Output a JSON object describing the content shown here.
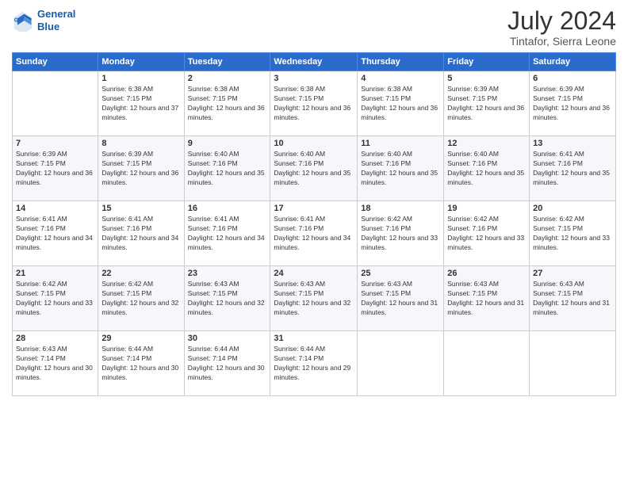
{
  "logo": {
    "line1": "General",
    "line2": "Blue"
  },
  "title": "July 2024",
  "location": "Tintafor, Sierra Leone",
  "weekdays": [
    "Sunday",
    "Monday",
    "Tuesday",
    "Wednesday",
    "Thursday",
    "Friday",
    "Saturday"
  ],
  "weeks": [
    [
      {
        "day": "",
        "sunrise": "",
        "sunset": "",
        "daylight": ""
      },
      {
        "day": "1",
        "sunrise": "Sunrise: 6:38 AM",
        "sunset": "Sunset: 7:15 PM",
        "daylight": "Daylight: 12 hours and 37 minutes."
      },
      {
        "day": "2",
        "sunrise": "Sunrise: 6:38 AM",
        "sunset": "Sunset: 7:15 PM",
        "daylight": "Daylight: 12 hours and 36 minutes."
      },
      {
        "day": "3",
        "sunrise": "Sunrise: 6:38 AM",
        "sunset": "Sunset: 7:15 PM",
        "daylight": "Daylight: 12 hours and 36 minutes."
      },
      {
        "day": "4",
        "sunrise": "Sunrise: 6:38 AM",
        "sunset": "Sunset: 7:15 PM",
        "daylight": "Daylight: 12 hours and 36 minutes."
      },
      {
        "day": "5",
        "sunrise": "Sunrise: 6:39 AM",
        "sunset": "Sunset: 7:15 PM",
        "daylight": "Daylight: 12 hours and 36 minutes."
      },
      {
        "day": "6",
        "sunrise": "Sunrise: 6:39 AM",
        "sunset": "Sunset: 7:15 PM",
        "daylight": "Daylight: 12 hours and 36 minutes."
      }
    ],
    [
      {
        "day": "7",
        "sunrise": "Sunrise: 6:39 AM",
        "sunset": "Sunset: 7:15 PM",
        "daylight": "Daylight: 12 hours and 36 minutes."
      },
      {
        "day": "8",
        "sunrise": "Sunrise: 6:39 AM",
        "sunset": "Sunset: 7:15 PM",
        "daylight": "Daylight: 12 hours and 36 minutes."
      },
      {
        "day": "9",
        "sunrise": "Sunrise: 6:40 AM",
        "sunset": "Sunset: 7:16 PM",
        "daylight": "Daylight: 12 hours and 35 minutes."
      },
      {
        "day": "10",
        "sunrise": "Sunrise: 6:40 AM",
        "sunset": "Sunset: 7:16 PM",
        "daylight": "Daylight: 12 hours and 35 minutes."
      },
      {
        "day": "11",
        "sunrise": "Sunrise: 6:40 AM",
        "sunset": "Sunset: 7:16 PM",
        "daylight": "Daylight: 12 hours and 35 minutes."
      },
      {
        "day": "12",
        "sunrise": "Sunrise: 6:40 AM",
        "sunset": "Sunset: 7:16 PM",
        "daylight": "Daylight: 12 hours and 35 minutes."
      },
      {
        "day": "13",
        "sunrise": "Sunrise: 6:41 AM",
        "sunset": "Sunset: 7:16 PM",
        "daylight": "Daylight: 12 hours and 35 minutes."
      }
    ],
    [
      {
        "day": "14",
        "sunrise": "Sunrise: 6:41 AM",
        "sunset": "Sunset: 7:16 PM",
        "daylight": "Daylight: 12 hours and 34 minutes."
      },
      {
        "day": "15",
        "sunrise": "Sunrise: 6:41 AM",
        "sunset": "Sunset: 7:16 PM",
        "daylight": "Daylight: 12 hours and 34 minutes."
      },
      {
        "day": "16",
        "sunrise": "Sunrise: 6:41 AM",
        "sunset": "Sunset: 7:16 PM",
        "daylight": "Daylight: 12 hours and 34 minutes."
      },
      {
        "day": "17",
        "sunrise": "Sunrise: 6:41 AM",
        "sunset": "Sunset: 7:16 PM",
        "daylight": "Daylight: 12 hours and 34 minutes."
      },
      {
        "day": "18",
        "sunrise": "Sunrise: 6:42 AM",
        "sunset": "Sunset: 7:16 PM",
        "daylight": "Daylight: 12 hours and 33 minutes."
      },
      {
        "day": "19",
        "sunrise": "Sunrise: 6:42 AM",
        "sunset": "Sunset: 7:16 PM",
        "daylight": "Daylight: 12 hours and 33 minutes."
      },
      {
        "day": "20",
        "sunrise": "Sunrise: 6:42 AM",
        "sunset": "Sunset: 7:15 PM",
        "daylight": "Daylight: 12 hours and 33 minutes."
      }
    ],
    [
      {
        "day": "21",
        "sunrise": "Sunrise: 6:42 AM",
        "sunset": "Sunset: 7:15 PM",
        "daylight": "Daylight: 12 hours and 33 minutes."
      },
      {
        "day": "22",
        "sunrise": "Sunrise: 6:42 AM",
        "sunset": "Sunset: 7:15 PM",
        "daylight": "Daylight: 12 hours and 32 minutes."
      },
      {
        "day": "23",
        "sunrise": "Sunrise: 6:43 AM",
        "sunset": "Sunset: 7:15 PM",
        "daylight": "Daylight: 12 hours and 32 minutes."
      },
      {
        "day": "24",
        "sunrise": "Sunrise: 6:43 AM",
        "sunset": "Sunset: 7:15 PM",
        "daylight": "Daylight: 12 hours and 32 minutes."
      },
      {
        "day": "25",
        "sunrise": "Sunrise: 6:43 AM",
        "sunset": "Sunset: 7:15 PM",
        "daylight": "Daylight: 12 hours and 31 minutes."
      },
      {
        "day": "26",
        "sunrise": "Sunrise: 6:43 AM",
        "sunset": "Sunset: 7:15 PM",
        "daylight": "Daylight: 12 hours and 31 minutes."
      },
      {
        "day": "27",
        "sunrise": "Sunrise: 6:43 AM",
        "sunset": "Sunset: 7:15 PM",
        "daylight": "Daylight: 12 hours and 31 minutes."
      }
    ],
    [
      {
        "day": "28",
        "sunrise": "Sunrise: 6:43 AM",
        "sunset": "Sunset: 7:14 PM",
        "daylight": "Daylight: 12 hours and 30 minutes."
      },
      {
        "day": "29",
        "sunrise": "Sunrise: 6:44 AM",
        "sunset": "Sunset: 7:14 PM",
        "daylight": "Daylight: 12 hours and 30 minutes."
      },
      {
        "day": "30",
        "sunrise": "Sunrise: 6:44 AM",
        "sunset": "Sunset: 7:14 PM",
        "daylight": "Daylight: 12 hours and 30 minutes."
      },
      {
        "day": "31",
        "sunrise": "Sunrise: 6:44 AM",
        "sunset": "Sunset: 7:14 PM",
        "daylight": "Daylight: 12 hours and 29 minutes."
      },
      {
        "day": "",
        "sunrise": "",
        "sunset": "",
        "daylight": ""
      },
      {
        "day": "",
        "sunrise": "",
        "sunset": "",
        "daylight": ""
      },
      {
        "day": "",
        "sunrise": "",
        "sunset": "",
        "daylight": ""
      }
    ]
  ]
}
